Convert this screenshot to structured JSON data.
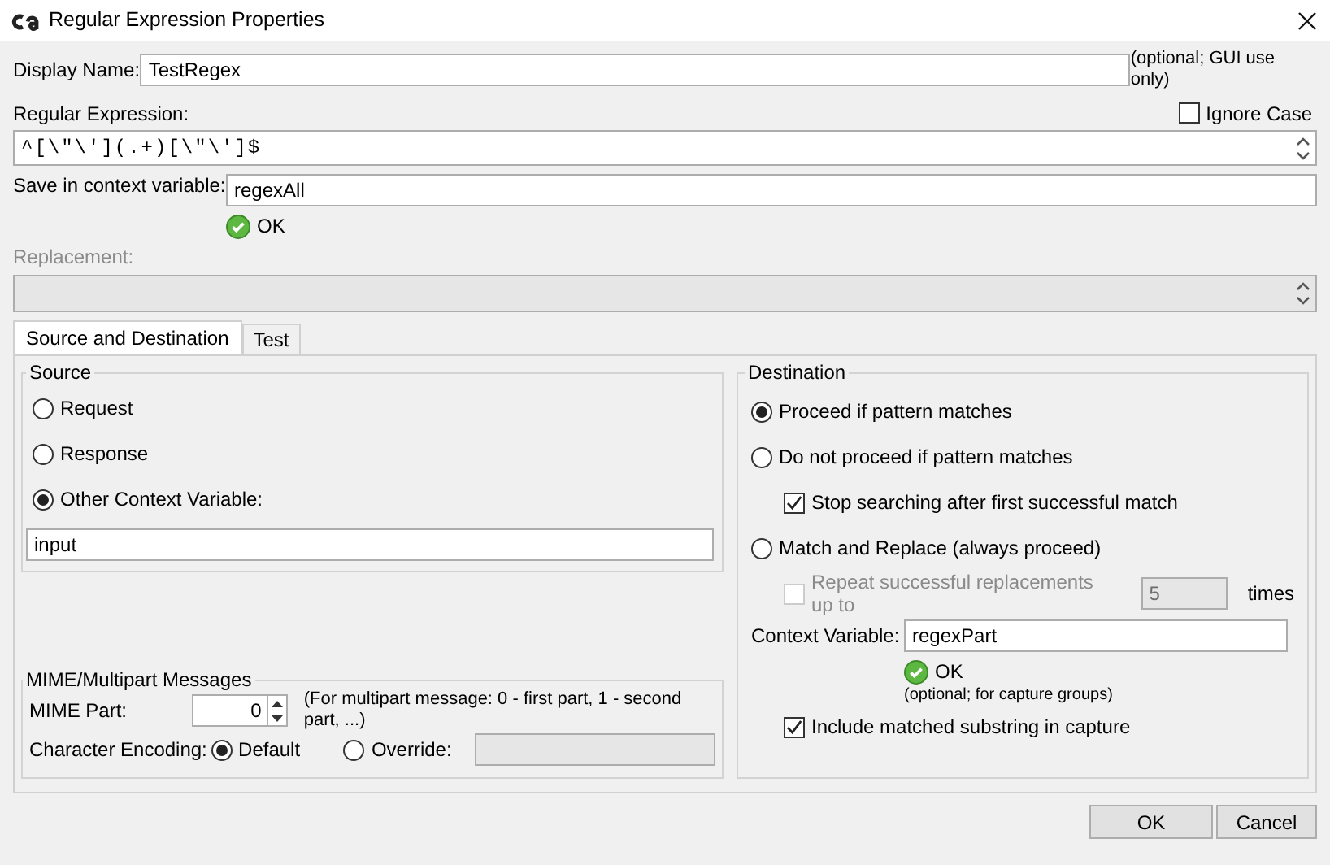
{
  "window": {
    "title": "Regular Expression Properties"
  },
  "display_name": {
    "label": "Display Name:",
    "value": "TestRegex",
    "hint": "(optional; GUI use only)"
  },
  "regex": {
    "label": "Regular Expression:",
    "value": "^[\\\"\\'](.+)[\\\"\\']$",
    "ignore_case": {
      "label": "Ignore Case",
      "checked": false
    }
  },
  "save_variable": {
    "label": "Save in context variable:",
    "value": "regexAll",
    "status": "OK"
  },
  "replacement": {
    "label": "Replacement:",
    "disabled": true
  },
  "tabs": [
    {
      "label": "Source and Destination",
      "selected": true
    },
    {
      "label": "Test",
      "selected": false
    }
  ],
  "source": {
    "title": "Source",
    "options": [
      {
        "label": "Request",
        "selected": false
      },
      {
        "label": "Response",
        "selected": false
      },
      {
        "label": "Other Context Variable:",
        "selected": true
      }
    ],
    "variable_value": "input"
  },
  "mime": {
    "title": "MIME/Multipart Messages",
    "part_label": "MIME Part:",
    "part_value": "0",
    "part_hint": "(For multipart message: 0 - first part, 1 - second part, ...)",
    "encoding_label": "Character Encoding:",
    "encoding_options": [
      {
        "label": "Default",
        "selected": true
      },
      {
        "label": "Override:",
        "selected": false
      }
    ]
  },
  "destination": {
    "title": "Destination",
    "options": [
      {
        "label": "Proceed if pattern matches",
        "selected": true
      },
      {
        "label": "Do not proceed if pattern matches",
        "selected": false,
        "sub_option": {
          "label": "Stop searching after first successful match",
          "checked": true,
          "disabled": false
        }
      },
      {
        "label": "Match and Replace (always proceed)",
        "selected": false,
        "sub_option": {
          "label": "Repeat successful replacements up to",
          "checked": false,
          "disabled": true,
          "count": "5",
          "suffix": "times"
        }
      }
    ],
    "context_variable": {
      "label": "Context Variable:",
      "value": "regexPart",
      "status": "OK",
      "hint": "(optional; for capture groups)"
    },
    "include_substring": {
      "label": "Include matched substring in capture",
      "checked": true
    }
  },
  "buttons": [
    {
      "label": "OK"
    },
    {
      "label": "Cancel"
    }
  ]
}
